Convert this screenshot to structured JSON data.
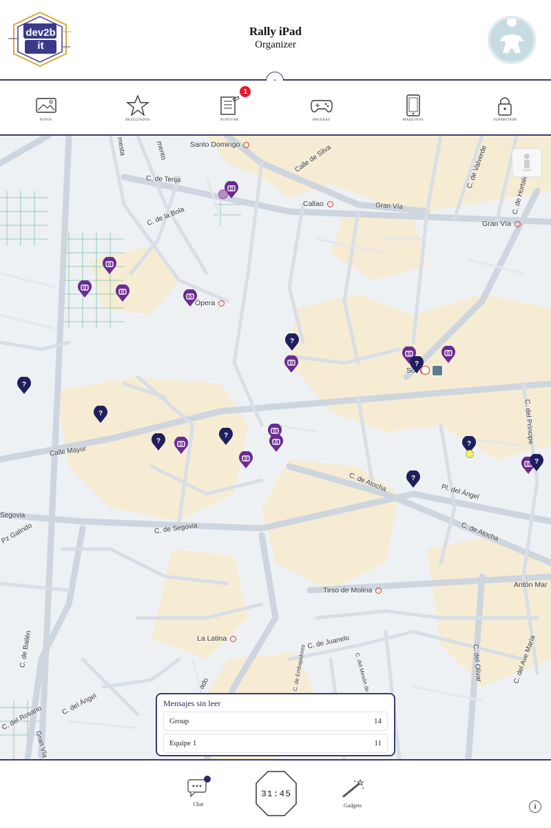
{
  "header": {
    "title": "Rally iPad",
    "subtitle": "Organizer",
    "logo_text": "dev2bit"
  },
  "toolbar": {
    "items": [
      {
        "label": "FOTOS",
        "icon": "photo-icon"
      },
      {
        "label": "RESULTADOS",
        "icon": "star-icon"
      },
      {
        "label": "PUNTUAR",
        "icon": "scoring-icon",
        "badge": "1"
      },
      {
        "label": "PRUEBAS",
        "icon": "gamepad-icon"
      },
      {
        "label": "MAQUINAS",
        "icon": "tablet-icon"
      },
      {
        "label": "SUPERVISOR",
        "icon": "lock-icon"
      }
    ]
  },
  "map": {
    "stations": [
      "Santo Domingo",
      "Callao",
      "Gran Vía",
      "Ópera",
      "Sol",
      "Tirso de Molina",
      "La Latina",
      "Antón Mar"
    ],
    "streets": [
      "C. de Terija",
      "C. de la Bola",
      "Calle de Silva",
      "Gran Vía",
      "C. de Valverde",
      "C. de Hortaleza",
      "Calle Mayor",
      "C. de Atocha",
      "Pl. del Ángel",
      "C. de Atocha",
      "C. del Príncipe",
      "C. de Segovia",
      "Segovia",
      "C. de Bailén",
      "C. de Juanelo",
      "C. del Olivar",
      "C. del Ave María",
      "C. del Ángel",
      "C. del Rosario",
      "Gran Vía",
      "Pz Galindo",
      "mento",
      "mesta",
      "ado",
      "C. de Embajadores",
      "C. del Mesón de Paredes"
    ],
    "pin_colors": {
      "question": "#1e1f5c",
      "photo": "#6a2c91"
    }
  },
  "messages": {
    "title": "Mensajes sin leer",
    "rows": [
      {
        "name": "Group",
        "count": "14"
      },
      {
        "name": "Equipe 1",
        "count": "11"
      }
    ]
  },
  "bottom": {
    "chat_label": "Chat",
    "timer": "31:45",
    "gadgets_label": "Gadgets",
    "info": "i"
  }
}
